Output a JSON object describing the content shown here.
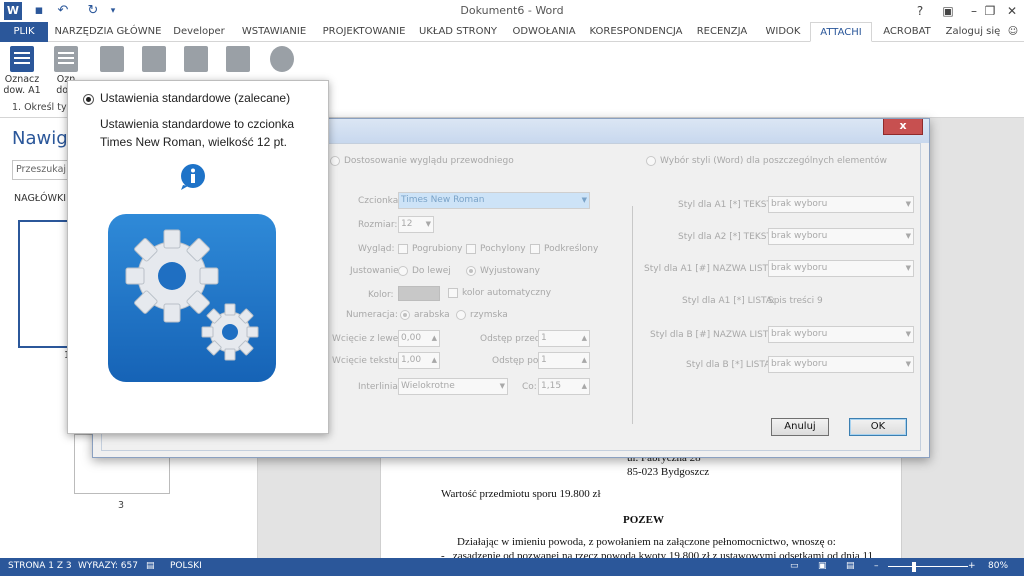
{
  "window": {
    "title": "Dokument6 - Word",
    "help": "?",
    "minimize": "–",
    "restore": "❐",
    "close": "✕"
  },
  "ribbon_tabs": [
    "PLIK",
    "NARZĘDZIA GŁÓWNE",
    "Developer",
    "WSTAWIANIE",
    "PROJEKTOWANIE",
    "UKŁAD STRONY",
    "ODWOŁANIA",
    "KORESPONDENCJA",
    "RECENZJA",
    "WIDOK",
    "ATTACHI",
    "ACROBAT"
  ],
  "account": "Zaloguj się",
  "ribbon": {
    "first_button_line1": "Oznacz",
    "first_button_line2": "dow. A1",
    "second_button_line1": "Ozn",
    "second_button_line2": "dow",
    "group_label": "1. Określ typ"
  },
  "nav": {
    "title": "Nawiga",
    "search_placeholder": "Przeszukaj d",
    "headings_tab": "NAGŁÓWKI",
    "page1": "1",
    "page3": "3"
  },
  "document": {
    "line1": "ul. Fabryczna 28",
    "line2": "85-023 Bydgoszcz",
    "line3": "Wartość przedmiotu sporu 19.800 zł",
    "heading": "POZEW",
    "para": "Działając w imieniu powoda, z powołaniem na załączone pełnomocnictwo, wnoszę o:",
    "bullet": "zasądzenie od pozwanej na rzecz powoda kwoty 19.800 zł z ustawowymi odsetkami od dnia 11"
  },
  "dialog": {
    "close": "x",
    "radio_left": "Dostosowanie wyglądu przewodniego",
    "radio_right": "Wybór styli (Word) dla poszczególnych elementów",
    "font_label": "Czcionka:",
    "font_value": "Times New Roman",
    "size_label": "Rozmiar:",
    "size_value": "12",
    "look_label": "Wygląd:",
    "bold": "Pogrubiony",
    "italic": "Pochylony",
    "underline": "Podkreślony",
    "align_label": "Justowanie:",
    "align_left": "Do lewej",
    "align_justify": "Wyjustowany",
    "color_label": "Kolor:",
    "auto_color": "kolor automatyczny",
    "numbering_label": "Numeracja:",
    "arabic": "arabska",
    "roman": "rzymska",
    "indent_left_label": "Wcięcie z lewej:",
    "indent_left_value": "0,00",
    "indent_text_label": "Wcięcie tekstu:",
    "indent_text_value": "1,00",
    "space_before_label": "Odstęp przed:",
    "space_before_value": "1",
    "space_after_label": "Odstęp po:",
    "space_after_value": "1",
    "line_spacing_label": "Interlinia:",
    "line_spacing_value": "Wielokrotne",
    "co_label": "Co:",
    "co_value": "1,15",
    "style_a1_text_label": "Styl dla A1 [*] TEKST:",
    "style_a2_text_label": "Styl dla A2 [*] TEKST:",
    "style_a1_name_label": "Styl dla A1 [#] NAZWA LISTY:",
    "style_a1_list_label": "Styl dla A1 [*] LISTA:",
    "style_a1_list_value": "Spis treści 9",
    "style_b_name_label": "Styl dla B [#] NAZWA LISTY:",
    "style_b_list_label": "Styl dla B [*] LISTA:",
    "no_selection": "brak wyboru",
    "cancel": "Anuluj",
    "ok": "OK"
  },
  "popup": {
    "option": "Ustawienia standardowe (zalecane)",
    "description": "Ustawienia standardowe to czcionka Times New Roman, wielkość 12 pt."
  },
  "status": {
    "page": "STRONA 1 Z 3",
    "words": "WYRAZY: 657",
    "language": "POLSKI",
    "zoom": "80%"
  },
  "colors": {
    "accent": "#2b579a",
    "gear_blue": "#1e73c8"
  }
}
